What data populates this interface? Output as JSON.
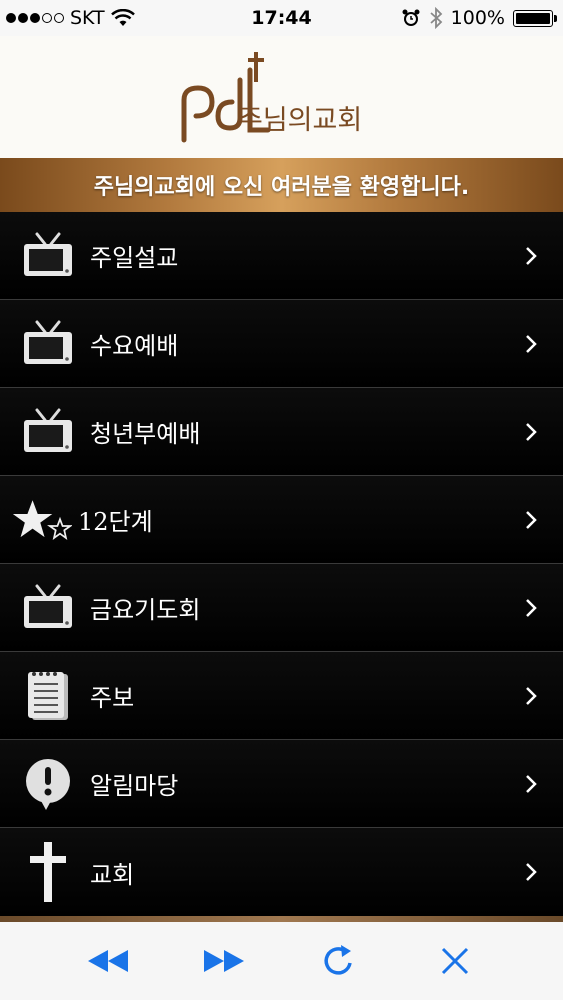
{
  "status_bar": {
    "carrier": "SKT",
    "time": "17:44",
    "battery": "100%",
    "signal_bars": 3
  },
  "header": {
    "logo_text": "주님의교회"
  },
  "banner": {
    "text": "주님의교회에 오신 여러분을 환영합니다."
  },
  "menu": {
    "items": [
      {
        "label": "주일설교",
        "icon": "tv-icon"
      },
      {
        "label": "수요예배",
        "icon": "tv-icon"
      },
      {
        "label": "청년부예배",
        "icon": "tv-icon"
      },
      {
        "label": "12단계",
        "icon": "stars-icon"
      },
      {
        "label": "금요기도회",
        "icon": "tv-icon"
      },
      {
        "label": "주보",
        "icon": "notepad-icon"
      },
      {
        "label": "알림마당",
        "icon": "alert-bubble-icon"
      },
      {
        "label": "교회",
        "icon": "cross-icon"
      }
    ]
  },
  "toolbar": {
    "buttons": [
      "rewind-icon",
      "fast-forward-icon",
      "refresh-icon",
      "close-icon"
    ],
    "accent": "#1a74e8"
  },
  "colors": {
    "banner_gold": "#c8904c",
    "logo_brown": "#7a4a22"
  }
}
